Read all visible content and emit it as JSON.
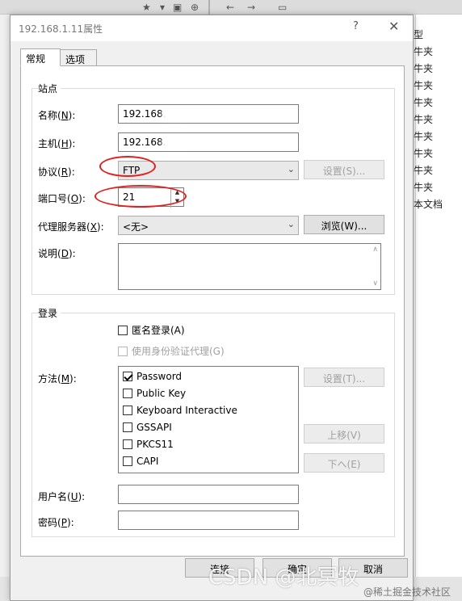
{
  "background": {
    "right_items": [
      "型",
      "牛夹",
      "牛夹",
      "牛夹",
      "牛夹",
      "牛夹",
      "牛夹",
      "牛夹",
      "牛夹",
      "牛夹",
      "本文档"
    ]
  },
  "dialog": {
    "title": "192.168.1.11属性",
    "help": "?",
    "close": "✕",
    "tabs": [
      "常规",
      "选项"
    ],
    "site_group": {
      "label": "站点",
      "name_label": "名称(",
      "name_key": "N",
      "name_value": "192.168.",
      "host_label": "主机(",
      "host_key": "H",
      "host_value": "192.168.",
      "protocol_label": "协议(",
      "protocol_key": "R",
      "protocol_value": "FTP",
      "settings_button": "设置(S)...",
      "port_label": "端口号(",
      "port_key": "O",
      "port_value": "21",
      "proxy_label": "代理服务器(",
      "proxy_key": "X",
      "proxy_value": "<无>",
      "browse_button": "浏览(W)...",
      "desc_label": "说明(",
      "desc_key": "D",
      "desc_value": ""
    },
    "login_group": {
      "label": "登录",
      "anonymous": "匿名登录(A)",
      "auth_proxy": "使用身份验证代理(G)",
      "method_label": "方法(",
      "method_key": "M",
      "methods": [
        {
          "label": "Password",
          "checked": true
        },
        {
          "label": "Public Key",
          "checked": false
        },
        {
          "label": "Keyboard Interactive",
          "checked": false
        },
        {
          "label": "GSSAPI",
          "checked": false
        },
        {
          "label": "PKCS11",
          "checked": false
        },
        {
          "label": "CAPI",
          "checked": false
        }
      ],
      "method_settings": "设置(T)...",
      "move_up": "上移(V)",
      "move_down": "下へ(E)",
      "user_label": "用户名(",
      "user_key": "U",
      "user_value": "",
      "password_label": "密码(",
      "password_key": "P",
      "password_value": ""
    },
    "footer": {
      "connect": "连接",
      "ok": "确定",
      "cancel": "取消"
    }
  },
  "watermark": {
    "main": "CSDN @北冥牧",
    "sub": "@稀土掘金技术社区"
  },
  "colors": {
    "annotation": "#e21f1f",
    "dialog_bg": "#f0f0f0"
  }
}
